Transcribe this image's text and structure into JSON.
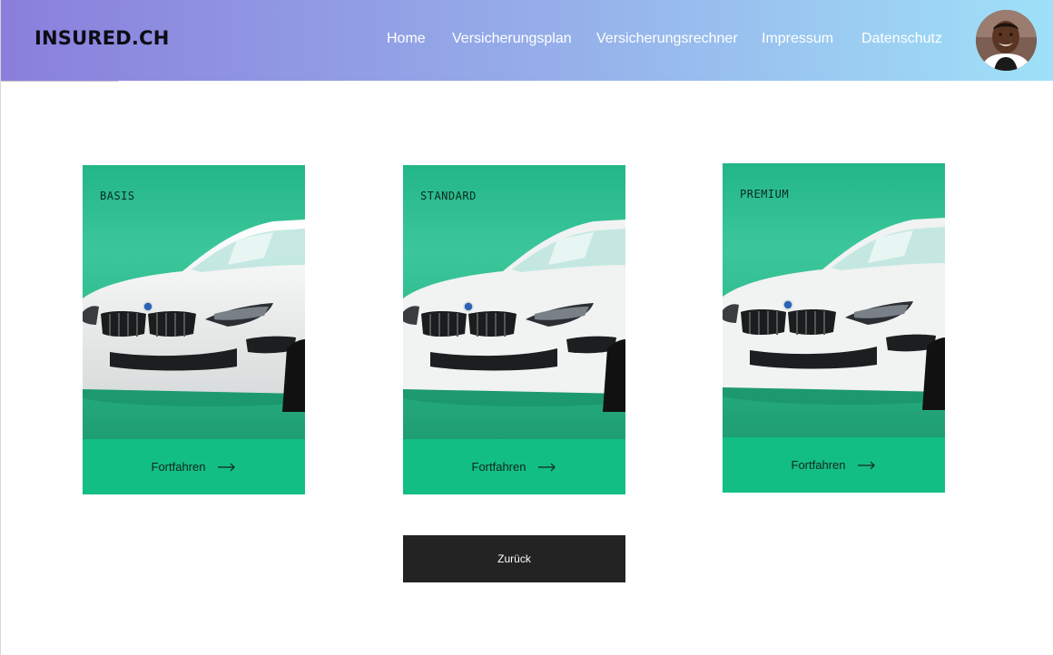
{
  "header": {
    "brand": "INSURED.CH",
    "nav": [
      {
        "id": "home",
        "label": "Home"
      },
      {
        "id": "plan",
        "label": "Versicherungsplan"
      },
      {
        "id": "calc",
        "label": "Versicherungsrechner"
      },
      {
        "id": "impressum",
        "label": "Impressum"
      },
      {
        "id": "privacy",
        "label": "Datenschutz"
      }
    ],
    "avatar_icon": "user-avatar-photo"
  },
  "plans": [
    {
      "label": "BASIS",
      "cta": "Fortfahren",
      "cta_icon": "arrow-right-icon"
    },
    {
      "label": "STANDARD",
      "cta": "Fortfahren",
      "cta_icon": "arrow-right-icon"
    },
    {
      "label": "PREMIUM",
      "cta": "Fortfahren",
      "cta_icon": "arrow-right-icon"
    }
  ],
  "back_button": {
    "label": "Zurück"
  },
  "colors": {
    "header_gradient_start": "#8a7fdc",
    "header_gradient_end": "#9fe1f8",
    "card_green": "#13bd84",
    "back_button": "#232323"
  }
}
